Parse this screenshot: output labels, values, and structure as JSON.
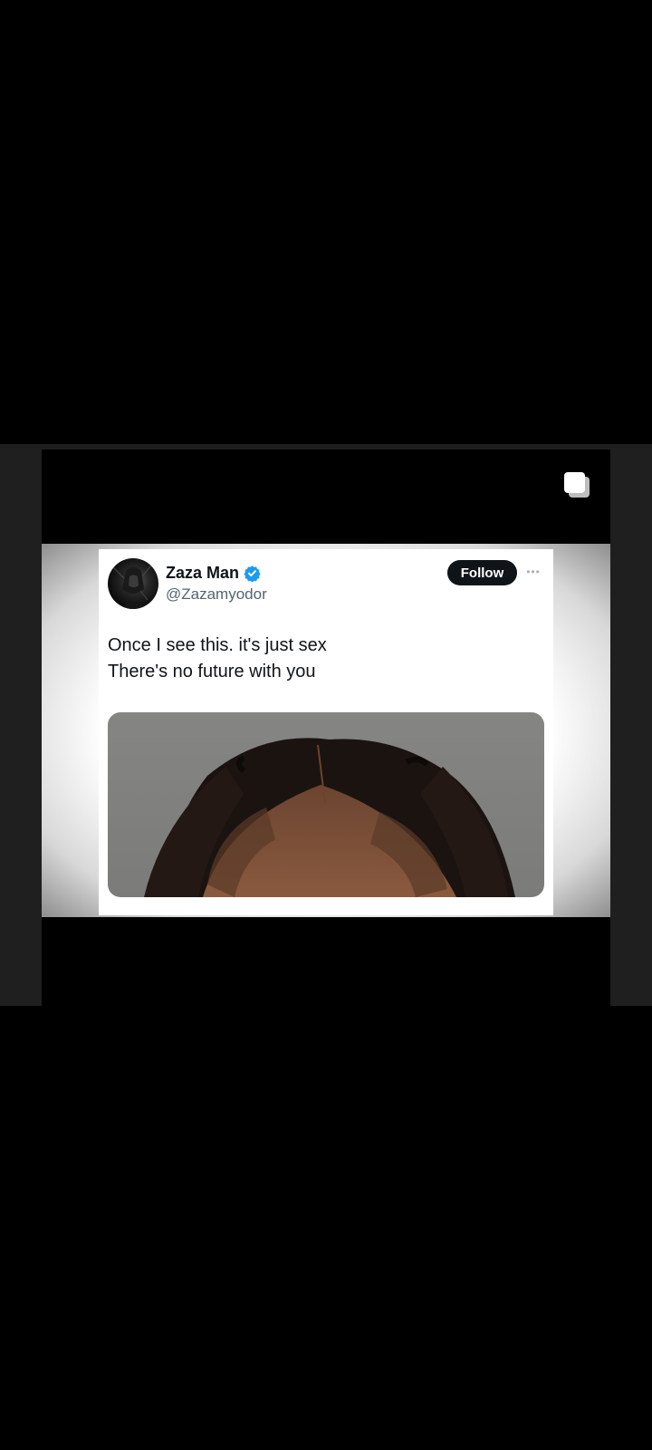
{
  "tweet": {
    "display_name": "Zaza Man",
    "handle": "@Zazamyodor",
    "follow_label": "Follow",
    "more_label": "•••",
    "text_lines": [
      "Once I see this. it's just sex",
      "There's no future with you"
    ]
  },
  "icons": {
    "gallery": "multiple-images-icon",
    "verified": "verified-badge-icon",
    "more": "more-options-icon"
  },
  "colors": {
    "verified": "#1d9bf0",
    "follow_button": "#0f1419",
    "handle": "#536471"
  }
}
